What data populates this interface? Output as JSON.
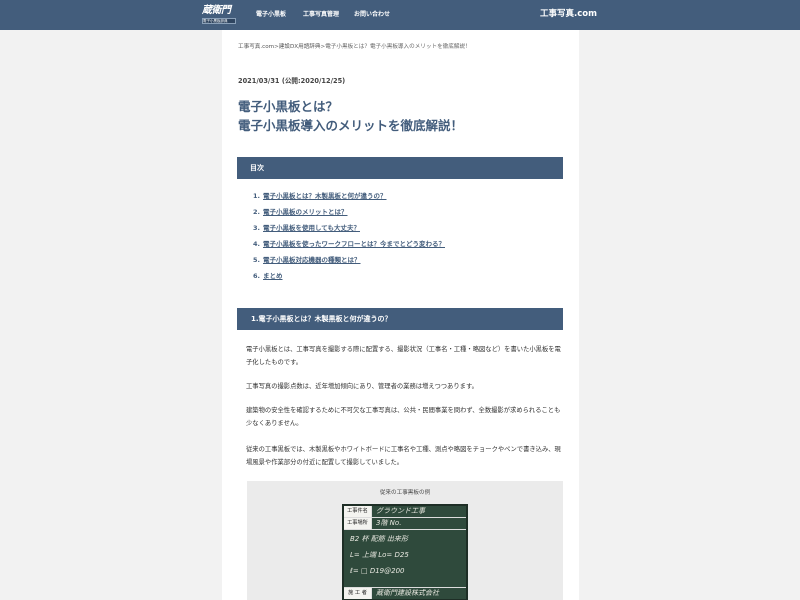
{
  "header": {
    "logo_main": "蔵衛門",
    "logo_sub": "電子小黒板辞典",
    "nav": [
      "電子小黒板",
      "工事写真管理",
      "お問い合わせ"
    ],
    "brand": "工事写真.com"
  },
  "breadcrumb": {
    "items": [
      "工事写真.com",
      "建設DX用語辞典",
      "電子小黒板とは？電子小黒板導入のメリットを徹底解説！"
    ],
    "separator": ">"
  },
  "article": {
    "date": "2021/03/31 (公開:2020/12/25)",
    "title_line1": "電子小黒板とは？",
    "title_line2": "電子小黒板導入のメリットを徹底解説！"
  },
  "toc": {
    "heading": "目次",
    "items": [
      {
        "num": "1.",
        "label": "電子小黒板とは？木製黒板と何が違うの？"
      },
      {
        "num": "2.",
        "label": "電子小黒板のメリットとは？"
      },
      {
        "num": "3.",
        "label": "電子小黒板を使用しても大丈夫？"
      },
      {
        "num": "4.",
        "label": "電子小黒板を使ったワークフローとは？今までとどう変わる？"
      },
      {
        "num": "5.",
        "label": "電子小黒板対応機器の種類とは？"
      },
      {
        "num": "6.",
        "label": "まとめ"
      }
    ]
  },
  "section1": {
    "heading": "1.電子小黒板とは？木製黒板と何が違うの？",
    "paragraphs": [
      "電子小黒板とは、工事写真を撮影する際に配置する、撮影状況（工事名・工種・略図など）を書いた小黒板を電子化したものです。",
      "工事写真の撮影点数は、近年増加傾向にあり、管理者の業務は増えつつあります。",
      "建築物の安全性を確認するために不可欠な工事写真は、公共・民間事業を問わず、全数撮影が求められることも少なくありません。",
      "従来の工事黒板では、木製黒板やホワイトボードに工事名や工種、測点や略図をチョークやペンで書き込み、現場風景や作業部分の付近に配置して撮影していました。"
    ]
  },
  "figure": {
    "caption": "従来の工事黒板の例",
    "board_labels": [
      "工事件名",
      "工事場所",
      "",
      "",
      "施 工 者"
    ],
    "board_handwriting": [
      "グラウンド工事",
      "3階 No.",
      "B2 杯  配筋 出来形",
      "L=   上端 Lo= D25",
      "ℓ=  □ D19@200",
      "蔵衛門建設株式会社"
    ]
  }
}
